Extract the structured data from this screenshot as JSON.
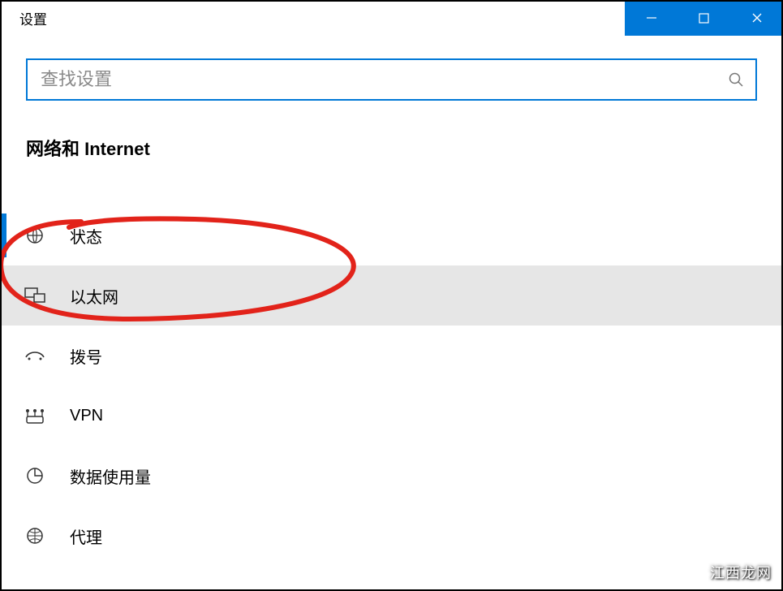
{
  "titlebar": {
    "title": "设置"
  },
  "search": {
    "placeholder": "查找设置"
  },
  "category": {
    "title": "网络和 Internet"
  },
  "nav": {
    "items": [
      {
        "icon": "status-icon",
        "label": "状态"
      },
      {
        "icon": "ethernet-icon",
        "label": "以太网"
      },
      {
        "icon": "dialup-icon",
        "label": "拨号"
      },
      {
        "icon": "vpn-icon",
        "label": "VPN"
      },
      {
        "icon": "data-icon",
        "label": "数据使用量"
      },
      {
        "icon": "proxy-icon",
        "label": "代理"
      }
    ]
  },
  "watermark": "江西龙网"
}
